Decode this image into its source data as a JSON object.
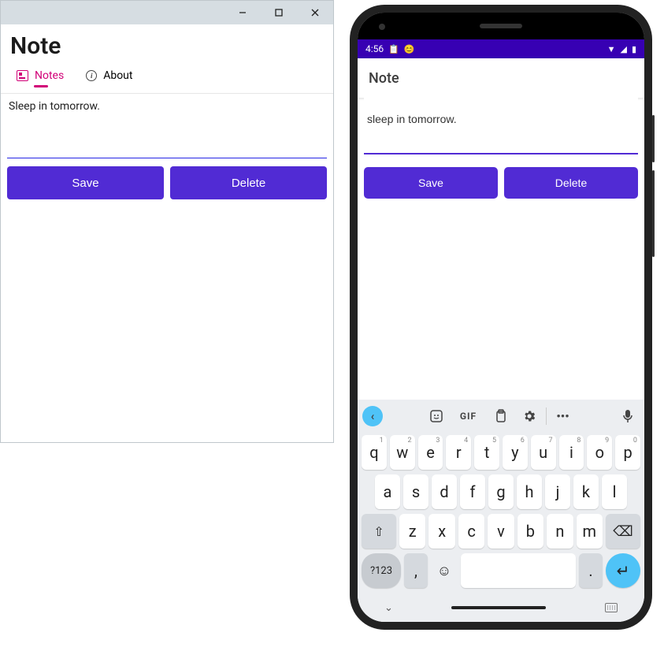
{
  "desktop": {
    "title": "Note",
    "tabs": {
      "notes": "Notes",
      "about": "About"
    },
    "editor": {
      "value": "Sleep in tomorrow."
    },
    "buttons": {
      "save": "Save",
      "delete": "Delete"
    }
  },
  "phone": {
    "status": {
      "time": "4:56",
      "icon1": "📋",
      "icon2": "😊",
      "wifi": "▼",
      "signal": "◢",
      "battery": "▮"
    },
    "appbar": {
      "title": "Note"
    },
    "editor": {
      "value": "sleep in tomorrow."
    },
    "buttons": {
      "save": "Save",
      "delete": "Delete"
    },
    "keyboard": {
      "toolbar": {
        "gif": "GIF"
      },
      "row1": [
        {
          "k": "q",
          "n": "1"
        },
        {
          "k": "w",
          "n": "2"
        },
        {
          "k": "e",
          "n": "3"
        },
        {
          "k": "r",
          "n": "4"
        },
        {
          "k": "t",
          "n": "5"
        },
        {
          "k": "y",
          "n": "6"
        },
        {
          "k": "u",
          "n": "7"
        },
        {
          "k": "i",
          "n": "8"
        },
        {
          "k": "o",
          "n": "9"
        },
        {
          "k": "p",
          "n": "0"
        }
      ],
      "row2": [
        "a",
        "s",
        "d",
        "f",
        "g",
        "h",
        "j",
        "k",
        "l"
      ],
      "row3": [
        "z",
        "x",
        "c",
        "v",
        "b",
        "n",
        "m"
      ],
      "sym": "?123",
      "comma": ",",
      "period": "."
    }
  }
}
